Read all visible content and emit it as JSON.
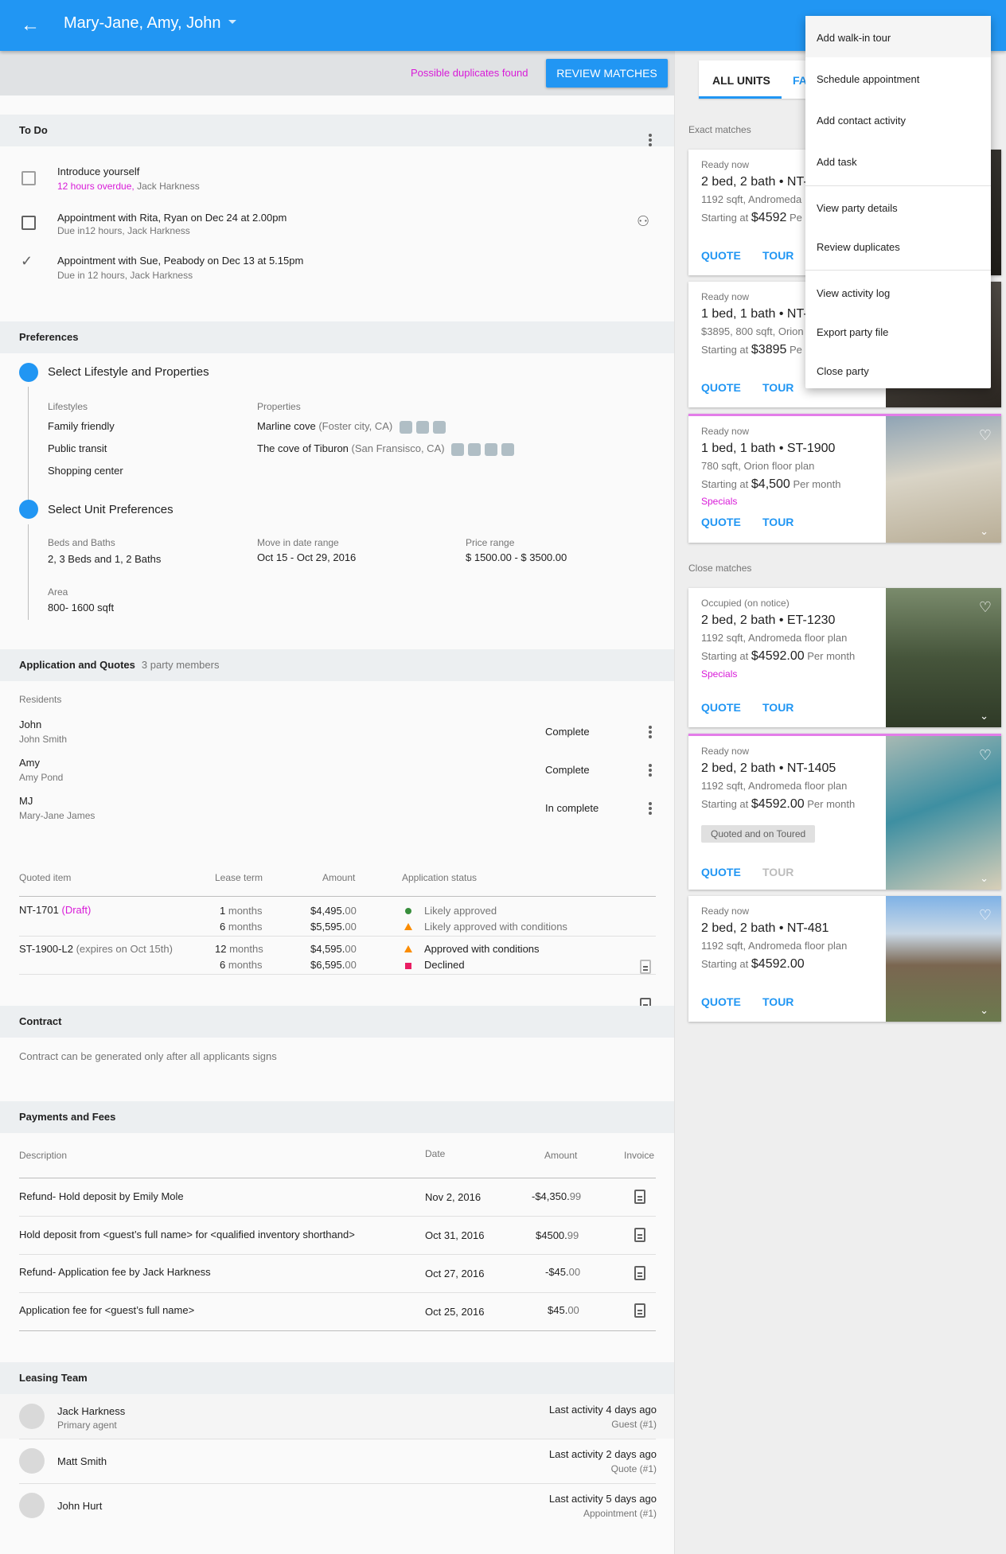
{
  "header": {
    "back_icon": "arrow-left-icon",
    "title": "Mary-Jane, Amy, John"
  },
  "duplicates": {
    "notice": "Possible duplicates found",
    "button": "REVIEW MATCHES"
  },
  "todo": {
    "title": "To Do",
    "items": [
      {
        "title": "Introduce yourself",
        "overdue": "12 hours overdue,",
        "agent": "Jack Harkness",
        "state": "unchecked"
      },
      {
        "title": "Appointment with Rita, Ryan on Dec 24 at 2.00pm",
        "due": "Due in12 hours,",
        "agent": "Jack Harkness",
        "state": "unchecked"
      },
      {
        "title": "Appointment with Sue, Peabody on Dec 13 at 5.15pm",
        "due": "Due in 12 hours,",
        "agent": "Jack Harkness",
        "state": "checked"
      }
    ]
  },
  "preferences": {
    "title": "Preferences",
    "lifestyle_title": "Select Lifestyle and Properties",
    "lifestyles_label": "Lifestyles",
    "lifestyles": [
      "Family friendly",
      "Public transit",
      "Shopping center"
    ],
    "properties_label": "Properties",
    "properties": [
      {
        "name": "Marline cove",
        "location": "(Foster city, CA)"
      },
      {
        "name": "The cove of Tiburon",
        "location": "(San Fransisco, CA)"
      }
    ],
    "unit_title": "Select Unit Preferences",
    "beds_label": "Beds and Baths",
    "beds_value": "2, 3 Beds and 1, 2 Baths",
    "movein_label": "Move in date range",
    "movein_value": "Oct 15 - Oct 29, 2016",
    "price_label": "Price range",
    "price_value": "$ 1500.00 - $ 3500.00",
    "area_label": "Area",
    "area_value": "800- 1600 sqft"
  },
  "applications": {
    "title": "Application and Quotes",
    "subtitle": "3 party members",
    "residents_label": "Residents",
    "residents": [
      {
        "short": "John",
        "full": "John Smith",
        "status": "Complete"
      },
      {
        "short": "Amy",
        "full": "Amy Pond",
        "status": "Complete"
      },
      {
        "short": "MJ",
        "full": "Mary-Jane James",
        "status": "In complete"
      }
    ],
    "quote_headers": {
      "item": "Quoted item",
      "lease": "Lease term",
      "amount": "Amount",
      "status": "Application status"
    },
    "quotes": [
      {
        "item": "NT-1701",
        "note": "(Draft)",
        "rows": [
          {
            "term_n": "1",
            "term_u": "months",
            "amount": "$4,495.",
            "cents": "00",
            "status": "Likely approved"
          },
          {
            "term_n": "6",
            "term_u": "months",
            "amount": "$5,595.",
            "cents": "00",
            "status": "Likely approved with conditions"
          }
        ]
      },
      {
        "item": "ST-1900-L2",
        "note": "(expires on Oct 15th)",
        "rows": [
          {
            "term_n": "12",
            "term_u": "months",
            "amount": "$4,595.",
            "cents": "00",
            "status": "Approved with conditions"
          },
          {
            "term_n": "6",
            "term_u": "months",
            "amount": "$6,595.",
            "cents": "00",
            "status": "Declined"
          }
        ]
      }
    ]
  },
  "contract": {
    "title": "Contract",
    "note": "Contract can be generated only after all applicants signs"
  },
  "payments": {
    "title": "Payments and Fees",
    "headers": {
      "description": "Description",
      "date": "Date",
      "amount": "Amount",
      "invoice": "Invoice"
    },
    "rows": [
      {
        "description": "Refund- Hold deposit by Emily Mole",
        "date": "Nov 2, 2016",
        "amount": "-$4,350.",
        "cents": "99"
      },
      {
        "description": "Hold deposit from <guest’s full name> for <qualified inventory shorthand>",
        "date": "Oct 31, 2016",
        "amount": "$4500.",
        "cents": "99"
      },
      {
        "description": "Refund- Application fee by Jack Harkness",
        "date": "Oct 27, 2016",
        "amount": "-$45.",
        "cents": "00"
      },
      {
        "description": "Application fee for <guest’s full name>",
        "date": "Oct 25, 2016",
        "amount": "$45.",
        "cents": "00"
      }
    ]
  },
  "leasing_team": {
    "title": "Leasing Team",
    "members": [
      {
        "name": "Jack Harkness",
        "role": "Primary agent",
        "activity": "Last activity 4 days ago",
        "detail": "Guest (#1)"
      },
      {
        "name": "Matt Smith",
        "role": "",
        "activity": "Last activity 2 days ago",
        "detail": "Quote (#1)"
      },
      {
        "name": "John Hurt",
        "role": "",
        "activity": "Last activity 5 days ago",
        "detail": "Appointment (#1)"
      }
    ]
  },
  "units": {
    "tabs": [
      "ALL UNITS",
      "FA"
    ],
    "exact_label": "Exact matches",
    "close_label": "Close matches",
    "exact": [
      {
        "status": "Ready now",
        "name": "2 bed, 2 bath",
        "code": "NT-",
        "plan": "1192 sqft, Andromeda",
        "price_prefix": "Starting at",
        "price": "$4592",
        "suffix": "Pe",
        "quote": "QUOTE",
        "tour": "TOUR"
      },
      {
        "status": "Ready now",
        "name": "1 bed, 1 bath",
        "code": "NT-",
        "plan": "$3895, 800 sqft, Orion",
        "price_prefix": "Starting at",
        "price": "$3895",
        "suffix": "Pe",
        "quote": "QUOTE",
        "tour": "TOUR"
      },
      {
        "status": "Ready now",
        "name": "1 bed, 1 bath",
        "code": "ST-1900",
        "plan": "780 sqft, Orion floor plan",
        "price_prefix": "Starting at",
        "price": "$4,500",
        "suffix": "Per month",
        "specials": "Specials",
        "quote": "QUOTE",
        "tour": "TOUR"
      }
    ],
    "close": [
      {
        "status": "Occupied (on notice)",
        "name": "2 bed, 2 bath",
        "code": "ET-1230",
        "plan": "1192 sqft, Andromeda floor plan",
        "price_prefix": "Starting at",
        "price": "$4592.00",
        "suffix": "Per month",
        "specials": "Specials",
        "quote": "QUOTE",
        "tour": "TOUR"
      },
      {
        "status": "Ready now",
        "name": "2 bed, 2 bath",
        "code": "NT-1405",
        "plan": "1192 sqft, Andromeda floor plan",
        "price_prefix": "Starting at",
        "price": "$4592.00",
        "suffix": "Per month",
        "badge": "Quoted and on Toured",
        "quote": "QUOTE",
        "tour": "TOUR"
      },
      {
        "status": "Ready now",
        "name": "2 bed, 2 bath",
        "code": "NT-481",
        "plan": "1192 sqft, Andromeda floor plan",
        "price_prefix": "Starting at",
        "price": "$4592.00",
        "suffix": "",
        "quote": "QUOTE",
        "tour": "TOUR"
      }
    ]
  },
  "menu": [
    "Add walk-in tour",
    "Schedule appointment",
    "Add contact activity",
    "Add task",
    "View party details",
    "Review duplicates",
    "View activity log",
    "Export party file",
    "Close party"
  ],
  "colors": {
    "primary": "#2196f3",
    "accent": "#d81bd8",
    "highlight": "#e37de9",
    "approved": "#388e3c",
    "conditions": "#fb8c00",
    "declined": "#e91e63"
  }
}
